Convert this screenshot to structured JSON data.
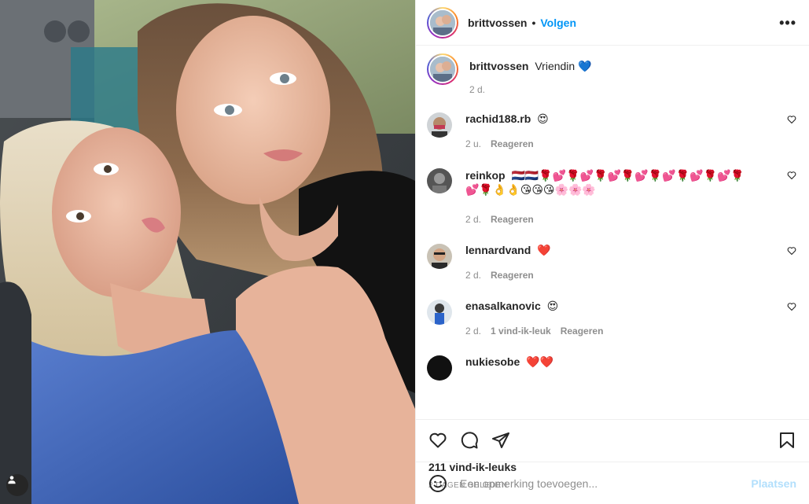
{
  "post": {
    "author": "brittvossen",
    "follow_label": "Volgen",
    "more_label": "•••",
    "caption": {
      "username": "brittvossen",
      "text": "Vriendin 💙",
      "time": "2 d."
    },
    "comments": [
      {
        "username": "rachid188.rb",
        "text": "😍",
        "time": "2 u.",
        "likes": "",
        "reply": "Reageren"
      },
      {
        "username": "reinkop",
        "text": "🇳🇱🇳🇱🌹💕🌹💕🌹💕🌹💕🌹💕🌹💕🌹💕🌹",
        "text2": "💕🌹👌👌😘😘😘🌸🌸🌸",
        "time": "2 d.",
        "likes": "",
        "reply": "Reageren"
      },
      {
        "username": "lennardvand",
        "text": "❤️",
        "time": "2 d.",
        "likes": "",
        "reply": "Reageren"
      },
      {
        "username": "enasalkanovic",
        "text": "😍",
        "time": "2 d.",
        "likes": "1 vind-ik-leuk",
        "reply": "Reageren"
      },
      {
        "username": "nukiesobe",
        "text": "❤️❤️"
      }
    ],
    "likes_label": "211 vind-ik-leuks",
    "date_label": "2 DAGEN GELEDEN",
    "comment_placeholder": "Een opmerking toevoegen...",
    "post_label": "Plaatsen"
  },
  "icons": [
    "user-tag-icon",
    "heart-icon",
    "comment-icon",
    "share-icon",
    "bookmark-icon",
    "emoji-icon",
    "more-icon"
  ],
  "colors": {
    "link": "#0095f6",
    "muted": "#8e8e8e",
    "text": "#262626",
    "post_disabled": "#b2dffc"
  }
}
